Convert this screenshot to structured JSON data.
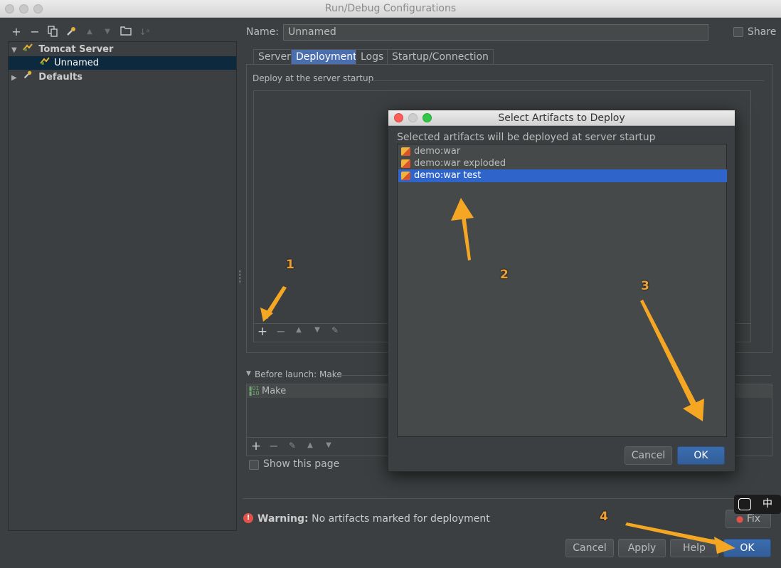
{
  "window": {
    "title": "Run/Debug Configurations"
  },
  "left_toolbar": {
    "icons": [
      "plus-icon",
      "minus-icon",
      "copy-icon",
      "wrench-icon",
      "arrow-up-icon",
      "arrow-down-icon",
      "folder-icon",
      "sort-icon"
    ]
  },
  "tree": {
    "items": [
      {
        "label": "Tomcat Server",
        "expanded": true
      },
      {
        "label": "Unnamed",
        "selected": true
      },
      {
        "label": "Defaults",
        "expanded": false
      }
    ]
  },
  "config": {
    "name_label": "Name:",
    "name_value": "Unnamed",
    "share_label": "Share",
    "tabs": [
      "Server",
      "Deployment",
      "Logs",
      "Startup/Connection"
    ],
    "active_tab": "Deployment",
    "deploy_group_label": "Deploy at the server startup",
    "before_launch_label": "Before launch: Make",
    "before_launch_items": [
      "Make"
    ],
    "show_page_label": "Show this page",
    "warning_bold": "Warning:",
    "warning_text": "No artifacts marked for deployment",
    "fix_label": "Fix"
  },
  "buttons": {
    "cancel": "Cancel",
    "apply": "Apply",
    "help": "Help",
    "ok": "OK"
  },
  "dialog": {
    "title": "Select Artifacts to Deploy",
    "description": "Selected artifacts will be deployed at server startup",
    "artifacts": [
      "demo:war",
      "demo:war exploded",
      "demo:war test"
    ],
    "selected_index": 2,
    "cancel_label": "Cancel",
    "ok_label": "OK"
  },
  "annotations": {
    "step1": "1",
    "step2": "2",
    "step3": "3",
    "step4": "4",
    "arrow_color": "#f5a623"
  },
  "ime_indicator": {
    "label": "中"
  },
  "colors": {
    "background": "#3c3f41",
    "selection": "#2f65ca",
    "tree_selection": "#0d293e",
    "default_button": "#3a6db0",
    "warning": "#e0524a"
  }
}
